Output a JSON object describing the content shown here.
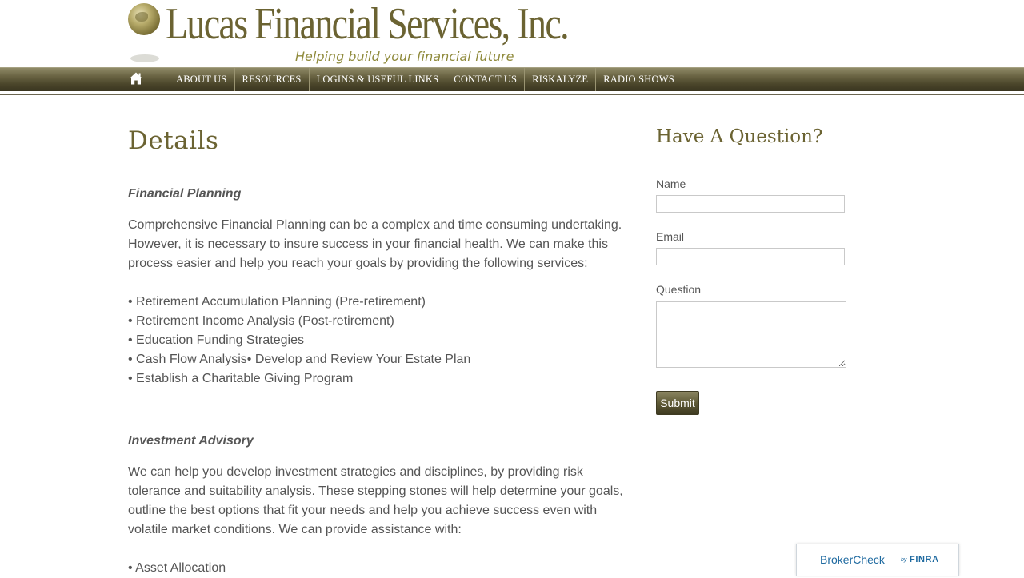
{
  "header": {
    "logo_title": "Lucas Financial Services, Inc.",
    "logo_tagline": "Helping build your financial future"
  },
  "nav": {
    "home_icon": "home-icon",
    "items": [
      {
        "label": "ABOUT US"
      },
      {
        "label": "RESOURCES"
      },
      {
        "label": "LOGINS & USEFUL LINKS"
      },
      {
        "label": "CONTACT US"
      },
      {
        "label": "RISKALYZE"
      },
      {
        "label": "RADIO SHOWS"
      }
    ]
  },
  "main": {
    "title": "Details",
    "sections": [
      {
        "heading": "Financial Planning",
        "paragraph": "Comprehensive Financial Planning can be a complex and time consuming undertaking. However, it is necessary to insure success in your financial health. We can make this process easier and help you reach your goals by providing the following services:",
        "bullets": [
          "• Retirement Accumulation Planning (Pre-retirement)",
          "• Retirement Income Analysis (Post-retirement)",
          "• Education Funding Strategies",
          "• Cash Flow Analysis• Develop and Review Your Estate Plan",
          "• Establish a Charitable Giving Program"
        ]
      },
      {
        "heading": "Investment Advisory",
        "paragraph": "We can help you develop investment strategies and disciplines, by providing risk tolerance and suitability analysis. These stepping stones will help determine your goals, outline the best options that fit your needs and help you achieve success even with volatile market conditions. We can provide assistance with:",
        "bullets": [
          "• Asset Allocation"
        ]
      }
    ]
  },
  "sidebar": {
    "title": "Have A Question?",
    "name_label": "Name",
    "name_value": "",
    "email_label": "Email",
    "email_value": "",
    "question_label": "Question",
    "question_value": "",
    "submit_label": "Submit"
  },
  "brokercheck": {
    "brand": "BrokerCheck",
    "by": "by",
    "finra": "FINRA"
  },
  "colors": {
    "brand_olive": "#6b6332",
    "nav_dark": "#4a452a",
    "text_gray": "#555555",
    "finra_blue": "#1f6aa0"
  }
}
